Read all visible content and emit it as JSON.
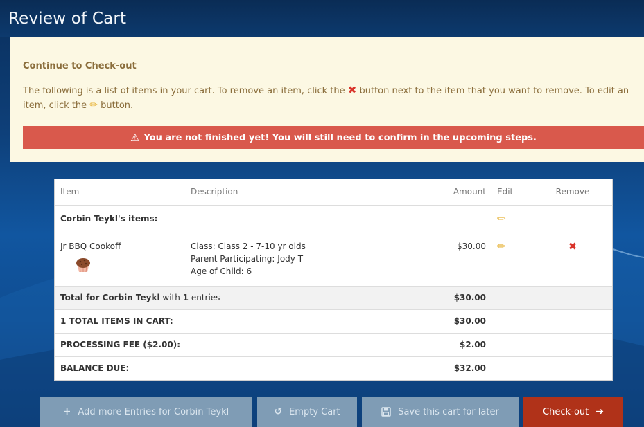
{
  "page": {
    "title": "Review of Cart"
  },
  "notice": {
    "heading": "Continue to Check-out",
    "text_part1": "The following is a list of items in your cart. To remove an item, click the",
    "text_part2": "button next to the item that you want to remove. To edit an item, click the",
    "text_part3": "button.",
    "warning": "You are not finished yet! You will still need to confirm in the upcoming steps."
  },
  "table": {
    "headers": {
      "item": "Item",
      "description": "Description",
      "amount": "Amount",
      "edit": "Edit",
      "remove": "Remove"
    },
    "owner_label": "Corbin Teykl's items:",
    "item": {
      "name": "Jr BBQ Cookoff",
      "desc_line1": "Class: Class 2 - 7-10 yr olds",
      "desc_line2": "Parent Participating: Jody T",
      "desc_line3": "Age of Child: 6",
      "amount": "$30.00"
    },
    "total_row": {
      "label_bold": "Total for Corbin Teykl",
      "label_with": " with ",
      "count": "1",
      "label_entries": " entries",
      "amount": "$30.00"
    },
    "items_in_cart": {
      "label": "1 TOTAL ITEMS IN CART:",
      "amount": "$30.00"
    },
    "processing_fee": {
      "label": "PROCESSING FEE ($2.00):",
      "amount": "$2.00"
    },
    "balance_due": {
      "label": "BALANCE DUE:",
      "amount": "$32.00"
    }
  },
  "buttons": {
    "add_entries": "Add more Entries for Corbin Teykl",
    "empty_cart": "Empty Cart",
    "save_later": "Save this cart for later",
    "checkout": "Check-out"
  },
  "icons": {
    "remove": "close-x-icon",
    "edit": "pencil-icon",
    "warning": "warning-triangle-icon",
    "add": "plus-icon",
    "empty": "undo-icon",
    "save": "floppy-disk-icon",
    "checkout": "arrow-right-icon",
    "item_image": "muffin-icon"
  },
  "colors": {
    "notice_bg": "#fcf8e3",
    "warning_bg": "#d9594c",
    "checkout_bg": "#b03219",
    "secondary_btn_bg": "#7f9cb5",
    "remove_red": "#d9342b",
    "edit_yellow": "#e7b43b"
  }
}
